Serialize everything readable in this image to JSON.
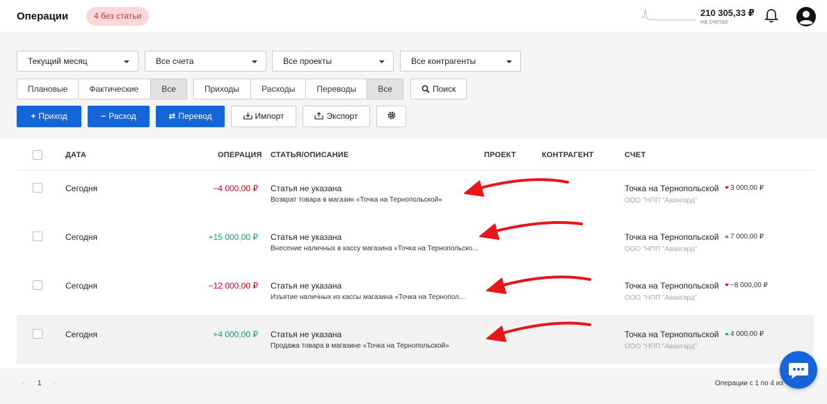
{
  "header": {
    "title": "Операции",
    "badge": "4 без статьи",
    "balance": "210 305,33 ₽",
    "balance_caption": "на счетах"
  },
  "filters": {
    "period": "Текущий месяц",
    "accounts": "Все счета",
    "projects": "Все проекты",
    "counterparties": "Все контрагенты"
  },
  "status_toggle": [
    "Плановые",
    "Фактические",
    "Все"
  ],
  "type_toggle": [
    "Приходы",
    "Расходы",
    "Переводы",
    "Все"
  ],
  "search_label": "Поиск",
  "actions": {
    "income": "Приход",
    "expense": "Расход",
    "transfer": "Перевод",
    "import": "Импорт",
    "export": "Экспорт"
  },
  "table": {
    "columns": {
      "date": "ДАТА",
      "operation": "ОПЕРАЦИЯ",
      "category": "СТАТЬЯ/ОПИСАНИЕ",
      "project": "ПРОЕКТ",
      "counterparty": "КОНТРАГЕНТ",
      "account": "СЧЕТ"
    },
    "rows": [
      {
        "date": "Сегодня",
        "amount": "−4 000,00 ₽",
        "category": "Статья не указана",
        "description": "Возврат товара в магазин «Точка на Тернопольской»",
        "account": "Точка на Тернопольской",
        "company": "ООО \"НПП \"Авангард\"",
        "account_balance": "3 000,00 ₽"
      },
      {
        "date": "Сегодня",
        "amount": "+15 000,00 ₽",
        "category": "Статья не указана",
        "description": "Внесение наличных в кассу магазина «Точка на Тернопольскo...",
        "account": "Точка на Тернопольской",
        "company": "ООО \"НПП \"Авангард\"",
        "account_balance": "7 000,00 ₽"
      },
      {
        "date": "Сегодня",
        "amount": "−12 000,00 ₽",
        "category": "Статья не указана",
        "description": "Изъятие наличных из кассы магазина «Точка на Тернопол...",
        "account": "Точка на Тернопольской",
        "company": "ООО \"НПП \"Авангард\"",
        "account_balance": "−8 000,00 ₽"
      },
      {
        "date": "Сегодня",
        "amount": "+4 000,00 ₽",
        "category": "Статья не указана",
        "description": "Продажа товара в магазине «Точка на Тернопольской»",
        "account": "Точка на Тернопольской",
        "company": "ООО \"НПП \"Авангард\"",
        "account_balance": "4 000,00 ₽"
      }
    ]
  },
  "pagination": {
    "prev": "‹",
    "current": "1",
    "next": "›",
    "info": "Операции с 1 по 4 из"
  },
  "colors": {
    "primary": "#1565d8",
    "negative": "#d0021b",
    "positive": "#21a05a",
    "badge_bg": "#fbd8d8",
    "annotation_arrow": "#e8151b"
  }
}
